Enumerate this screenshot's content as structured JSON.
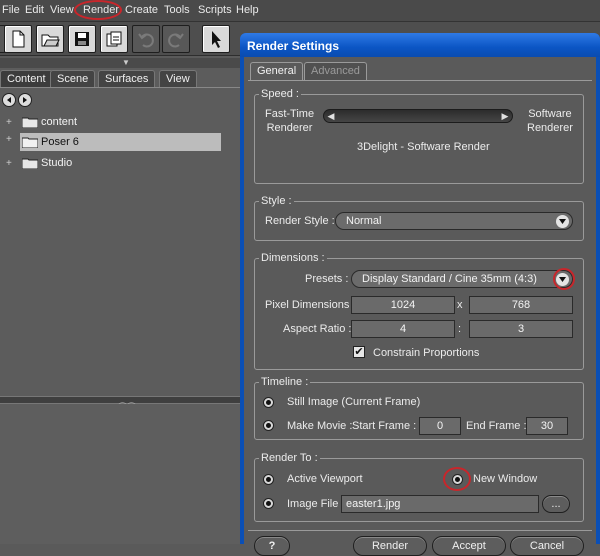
{
  "menu": [
    "File",
    "Edit",
    "View",
    "Render",
    "Create",
    "Tools",
    "Scripts",
    "Help"
  ],
  "toolbar": {
    "icons": [
      "new-icon",
      "open-icon",
      "save-icon",
      "import-icon",
      "undo-icon",
      "redo-icon",
      "pointer-icon"
    ]
  },
  "left_panel": {
    "tabs": [
      "Content",
      "Scene",
      "Surfaces",
      "View"
    ],
    "tree": [
      {
        "label": "content"
      },
      {
        "label": "Poser 6",
        "selected": true
      },
      {
        "label": "Studio"
      }
    ]
  },
  "dialog": {
    "title": "Render Settings",
    "tabs": [
      "General",
      "Advanced"
    ],
    "speed": {
      "title": "Speed :",
      "left_label": "Fast-Time\nRenderer",
      "right_label": "Software\nRenderer",
      "caption": "3Delight - Software Render"
    },
    "style": {
      "title": "Style :",
      "label": "Render Style :",
      "value": "Normal"
    },
    "dimensions": {
      "title": "Dimensions :",
      "presets_label": "Presets :",
      "presets_value": "Display Standard / Cine 35mm (4:3)",
      "pixel_label": "Pixel Dimensions :",
      "width": "1024",
      "x_sep": "x",
      "height": "768",
      "aspect_label": "Aspect Ratio :",
      "aspect_w": "4",
      "aspect_sep": ":",
      "aspect_h": "3",
      "constrain_label": "Constrain Proportions",
      "constrain_checked": true
    },
    "timeline": {
      "title": "Timeline :",
      "still_label": "Still Image (Current Frame)",
      "movie_label": "Make Movie :",
      "start_label": "Start Frame :",
      "start_value": "0",
      "end_label": "End Frame :",
      "end_value": "30"
    },
    "render_to": {
      "title": "Render To :",
      "viewport_label": "Active Viewport",
      "window_label": "New Window",
      "file_label": "Image File :",
      "file_value": "easter1.jpg",
      "browse_label": "..."
    },
    "buttons": {
      "help": "?",
      "render": "Render",
      "accept": "Accept",
      "cancel": "Cancel"
    }
  },
  "colors": {
    "annotation": "#c8262b",
    "title_bar": "#0b55c4",
    "panel_bg": "#5a5a5a"
  }
}
